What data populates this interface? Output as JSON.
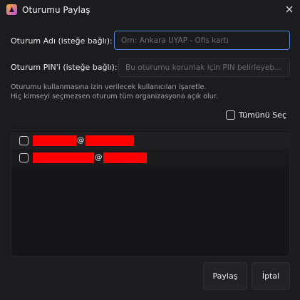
{
  "window": {
    "title": "Oturumu Paylaş",
    "icon": "app-logo-icon",
    "close_icon": "close-icon"
  },
  "form": {
    "name_label": "Oturum Adı (isteğe bağlı):",
    "name_placeholder": "Örn: Ankara UYAP - Ofis kartı",
    "name_value": "",
    "pin_label": "Oturum PIN'i (isteğe bağlı):",
    "pin_placeholder": "Bu oturumu korumak için PIN belirleyeb...",
    "pin_value": ""
  },
  "info": {
    "line1": "Oturumu kullanmasına izin verilecek kullanıcıları işaretle.",
    "line2": "Hiç kimseyi seçmezsen oturum tüm organizasyona açık olur."
  },
  "select_all": {
    "label": "Tümünü Seç",
    "checked": false
  },
  "users": [
    {
      "at": "@",
      "checked": false,
      "redacted": true
    },
    {
      "at": "@",
      "checked": false,
      "redacted": true
    }
  ],
  "buttons": {
    "share": "Paylaş",
    "cancel": "İptal"
  },
  "colors": {
    "background": "#1c1c1e",
    "focus_border": "#4f86d8",
    "redaction": "#ff0000"
  }
}
